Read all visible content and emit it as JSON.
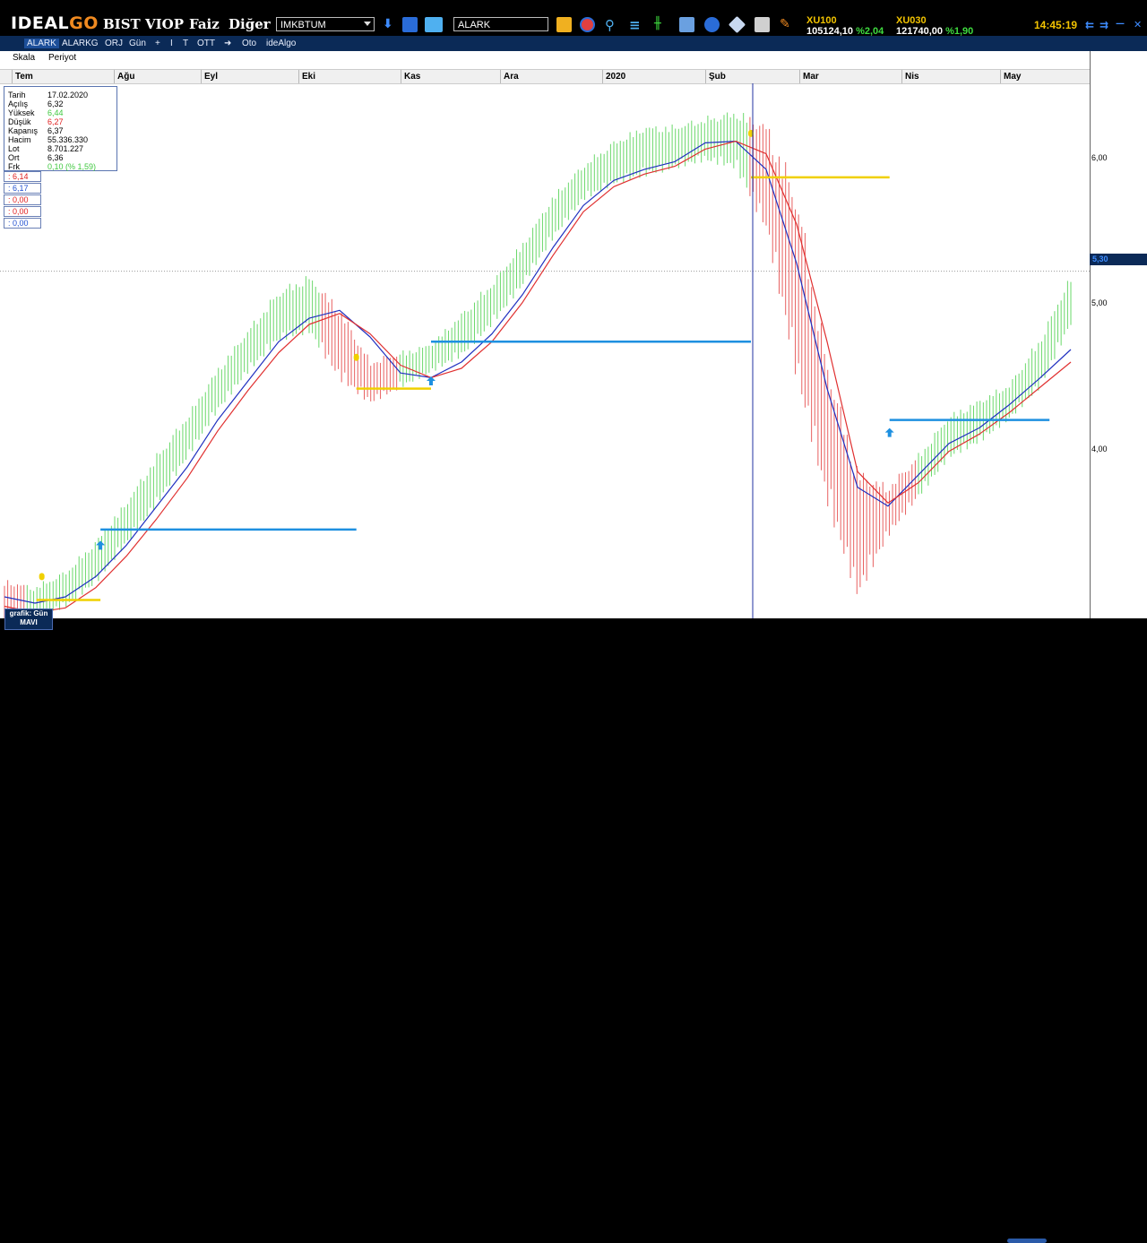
{
  "app": {
    "logo_main": "IDEAL",
    "logo_accent": "GO",
    "menu": [
      "BIST",
      "VIOP",
      "Faiz",
      "Diğer"
    ],
    "combo1": "IMKBTUM",
    "symbol_input": "ALARK",
    "indices": [
      {
        "name": "XU100",
        "value": "105124,10",
        "change": "%2,04"
      },
      {
        "name": "XU030",
        "value": "121740,00",
        "change": "%1,90"
      }
    ],
    "clock": "14:45:19",
    "window_buttons": [
      "⇇",
      "⇉",
      "—",
      "□",
      "✕"
    ]
  },
  "subbar": {
    "items": [
      "ALARK",
      "ALARKG",
      "ORJ",
      "Gün",
      "+",
      "I",
      "T",
      "OTT",
      "➜",
      "Oto",
      "ideAlgo"
    ]
  },
  "chart_menu": {
    "scale": "Skala",
    "period": "Periyot"
  },
  "infobox": {
    "rows": [
      {
        "label": "Tarih",
        "value": "17.02.2020",
        "color": "#000000"
      },
      {
        "label": "Açılış",
        "value": "6,32",
        "color": "#000000"
      },
      {
        "label": "Yüksek",
        "value": "6,44",
        "color": "#3fc83f"
      },
      {
        "label": "Düşük",
        "value": "6,27",
        "color": "#e02020"
      },
      {
        "label": "Kapanış",
        "value": "6,37",
        "color": "#000000"
      },
      {
        "label": "Hacim",
        "value": "55.336.330",
        "color": "#000000"
      },
      {
        "label": "Lot",
        "value": "8.701.227",
        "color": "#000000"
      },
      {
        "label": "Ort",
        "value": "6,36",
        "color": "#000000"
      },
      {
        "label": "Frk",
        "value": "0,10 (% 1,59)",
        "color": "#3fc83f"
      }
    ]
  },
  "indicators": [
    {
      "label": ": 6,14",
      "color": "#e02020"
    },
    {
      "label": ": 6,17",
      "color": "#2050d0"
    },
    {
      "label": ": 0,00",
      "color": "#e02020"
    },
    {
      "label": ": 0,00",
      "color": "#e02020"
    },
    {
      "label": ": 0,00",
      "color": "#2050d0"
    }
  ],
  "grafik_badge": {
    "line1": "grafik: Gün",
    "line2": "MAVI"
  },
  "chart_data": {
    "type": "line",
    "symbol": "ALARK",
    "period": "daily",
    "x_months": [
      "Tem",
      "Ağu",
      "Eyl",
      "Eki",
      "Kas",
      "Ara",
      "2020",
      "Şub",
      "Mar",
      "Nis",
      "May"
    ],
    "y_ticks": [
      "6,00",
      "5,00",
      "4,00"
    ],
    "ylim": [
      3.1,
      6.5
    ],
    "current_price_label": "5,30",
    "current_price": 5.3,
    "crosshair_date": "17.02.2020",
    "series": [
      {
        "color": "#2030c0",
        "values": [
          3.22,
          3.18,
          3.22,
          3.35,
          3.55,
          3.8,
          4.05,
          4.35,
          4.6,
          4.85,
          5.0,
          5.05,
          4.88,
          4.65,
          4.62,
          4.72,
          4.9,
          5.15,
          5.45,
          5.72,
          5.88,
          5.95,
          6.0,
          6.12,
          6.13,
          5.95,
          5.35,
          4.55,
          3.92,
          3.8,
          4.0,
          4.2,
          4.3,
          4.45,
          4.62,
          4.8
        ]
      },
      {
        "color": "#e03030",
        "values": [
          3.16,
          3.12,
          3.15,
          3.28,
          3.48,
          3.72,
          3.98,
          4.28,
          4.54,
          4.78,
          4.96,
          5.03,
          4.9,
          4.7,
          4.62,
          4.68,
          4.85,
          5.1,
          5.4,
          5.68,
          5.84,
          5.92,
          5.97,
          6.08,
          6.13,
          6.05,
          5.6,
          4.85,
          4.02,
          3.82,
          3.95,
          4.15,
          4.26,
          4.4,
          4.56,
          4.72
        ]
      }
    ],
    "price_high": [
      3.35,
      3.3,
      3.4,
      3.6,
      3.85,
      4.15,
      4.4,
      4.7,
      4.95,
      5.2,
      5.3,
      5.1,
      4.75,
      4.8,
      4.85,
      5.05,
      5.25,
      5.5,
      5.8,
      6.0,
      6.15,
      6.25,
      6.25,
      6.3,
      6.35,
      6.3,
      5.9,
      4.8,
      4.1,
      3.95,
      4.15,
      4.4,
      4.5,
      4.6,
      4.9,
      5.3
    ],
    "price_low": [
      3.05,
      3.08,
      3.15,
      3.3,
      3.55,
      3.8,
      4.1,
      4.4,
      4.65,
      4.85,
      4.9,
      4.6,
      4.45,
      4.55,
      4.65,
      4.75,
      4.95,
      5.2,
      5.5,
      5.75,
      5.85,
      5.9,
      5.95,
      6.0,
      5.95,
      5.55,
      4.6,
      3.8,
      3.2,
      3.6,
      3.85,
      4.1,
      4.2,
      4.35,
      4.55,
      4.95
    ],
    "horizontal_levels": [
      {
        "color": "#1e90e0",
        "y": 3.65,
        "from": 0.09,
        "to": 0.33
      },
      {
        "color": "#f0d000",
        "y": 3.2,
        "from": 0.03,
        "to": 0.09
      },
      {
        "color": "#f0d000",
        "y": 4.55,
        "from": 0.33,
        "to": 0.4
      },
      {
        "color": "#1e90e0",
        "y": 4.85,
        "from": 0.4,
        "to": 0.7
      },
      {
        "color": "#f0d000",
        "y": 5.9,
        "from": 0.7,
        "to": 0.83
      },
      {
        "color": "#1e90e0",
        "y": 4.35,
        "from": 0.83,
        "to": 0.98
      }
    ],
    "signals": [
      {
        "type": "buy",
        "color": "#1e90e0",
        "x": 0.09,
        "y": 3.55
      },
      {
        "type": "sell",
        "color": "#f0d000",
        "x": 0.035,
        "y": 3.35
      },
      {
        "type": "sell",
        "color": "#f0d000",
        "x": 0.33,
        "y": 4.75
      },
      {
        "type": "buy",
        "color": "#1e90e0",
        "x": 0.4,
        "y": 4.6
      },
      {
        "type": "sell",
        "color": "#f0d000",
        "x": 0.7,
        "y": 6.18
      },
      {
        "type": "buy",
        "color": "#1e90e0",
        "x": 0.83,
        "y": 4.27
      }
    ]
  }
}
